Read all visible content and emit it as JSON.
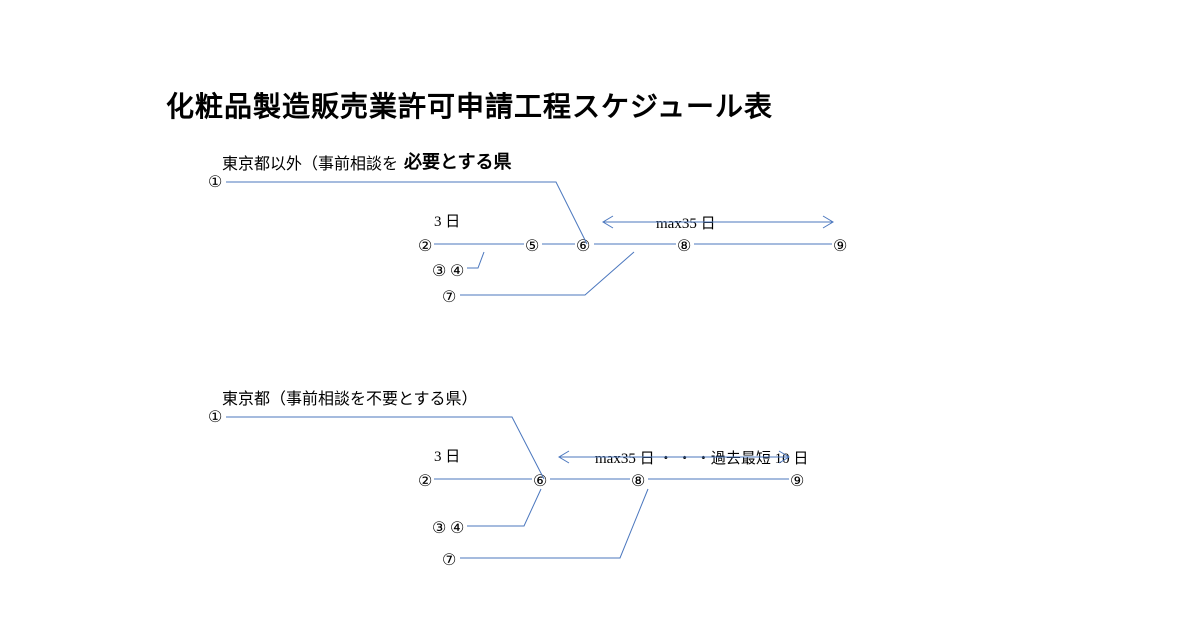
{
  "title": "化粧品製造販売業許可申請工程スケジュール表",
  "diagram1": {
    "subtitle_a": "東京都以外（事前相談を",
    "subtitle_b": "必要とする県",
    "label_3days": "3 日",
    "label_max35": "max35 日",
    "nodes": {
      "n1": "①",
      "n2": "②",
      "n3": "③",
      "n4": "④",
      "n5": "⑤",
      "n6": "⑥",
      "n7": "⑦",
      "n8": "⑧",
      "n9": "⑨"
    }
  },
  "diagram2": {
    "subtitle": "東京都（事前相談を不要とする県）",
    "label_3days": "3 日",
    "label_max35": "max35 日 ・ ・ ・過去最短 10 日",
    "nodes": {
      "n1": "①",
      "n2": "②",
      "n3": "③",
      "n4": "④",
      "n6": "⑥",
      "n7": "⑦",
      "n8": "⑧",
      "n9": "⑨"
    }
  }
}
